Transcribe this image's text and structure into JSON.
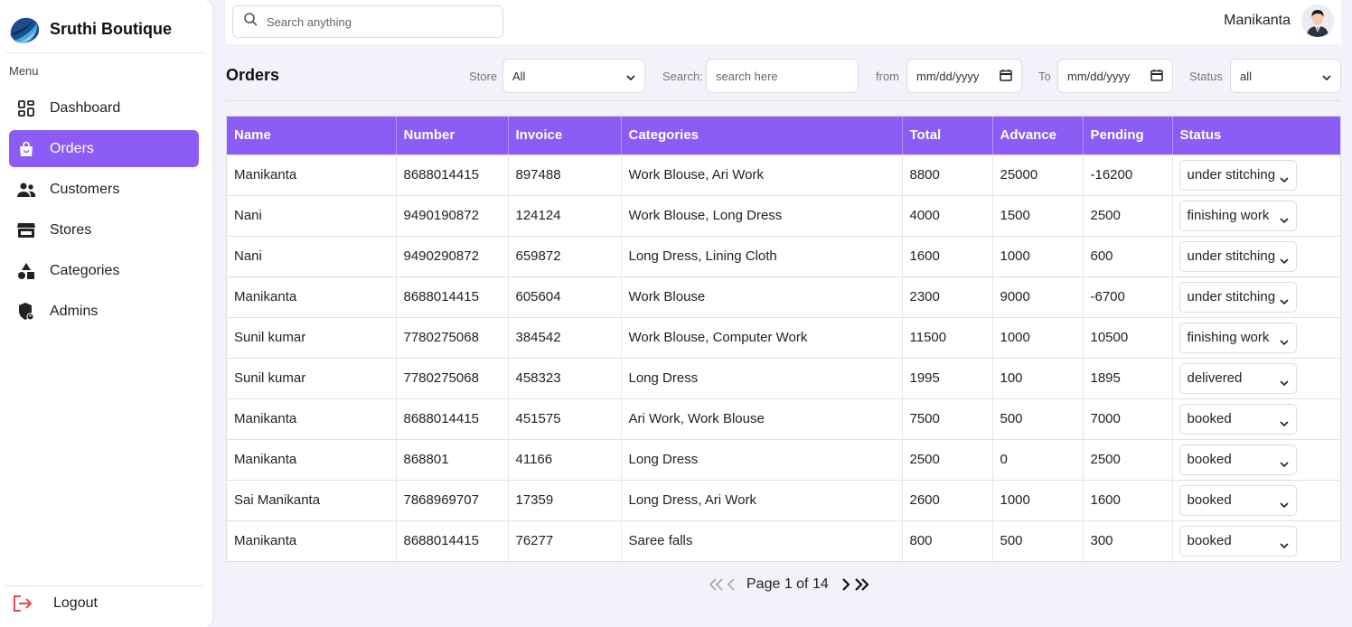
{
  "brand": {
    "name": "Sruthi Boutique"
  },
  "sidebar": {
    "menu_label": "Menu",
    "items": [
      {
        "label": "Dashboard",
        "icon": "dashboard-icon"
      },
      {
        "label": "Orders",
        "icon": "shopping-bag-icon"
      },
      {
        "label": "Customers",
        "icon": "users-icon"
      },
      {
        "label": "Stores",
        "icon": "store-icon"
      },
      {
        "label": "Categories",
        "icon": "shapes-icon"
      },
      {
        "label": "Admins",
        "icon": "shield-icon"
      }
    ],
    "active": "Orders",
    "logout_label": "Logout"
  },
  "topbar": {
    "search_placeholder": "Search anything",
    "user_name": "Manikanta"
  },
  "filters": {
    "title": "Orders",
    "store_label": "Store",
    "store_value": "All",
    "search_label": "Search:",
    "search_placeholder": "search here",
    "from_label": "from",
    "from_value": "mm/dd/yyyy",
    "to_label": "To",
    "to_value": "mm/dd/yyyy",
    "status_label": "Status",
    "status_value": "all"
  },
  "table": {
    "headers": [
      "Name",
      "Number",
      "Invoice",
      "Categories",
      "Total",
      "Advance",
      "Pending",
      "Status"
    ],
    "rows": [
      [
        "Manikanta",
        "8688014415",
        "897488",
        "Work Blouse, Ari Work",
        "8800",
        "25000",
        "-16200",
        "under stitching"
      ],
      [
        "Nani",
        "9490190872",
        "124124",
        "Work Blouse, Long Dress",
        "4000",
        "1500",
        "2500",
        "finishing work"
      ],
      [
        "Nani",
        "9490290872",
        "659872",
        "Long Dress, Lining Cloth",
        "1600",
        "1000",
        "600",
        "under stitching"
      ],
      [
        "Manikanta",
        "8688014415",
        "605604",
        "Work Blouse",
        "2300",
        "9000",
        "-6700",
        "under stitching"
      ],
      [
        "Sunil kumar",
        "7780275068",
        "384542",
        "Work Blouse, Computer Work",
        "11500",
        "1000",
        "10500",
        "finishing work"
      ],
      [
        "Sunil kumar",
        "7780275068",
        "458323",
        "Long Dress",
        "1995",
        "100",
        "1895",
        "delivered"
      ],
      [
        "Manikanta",
        "8688014415",
        "451575",
        "Ari Work, Work Blouse",
        "7500",
        "500",
        "7000",
        "booked"
      ],
      [
        "Manikanta",
        "868801",
        "41166",
        "Long Dress",
        "2500",
        "0",
        "2500",
        "booked"
      ],
      [
        "Sai Manikanta",
        "7868969707",
        "17359",
        "Long Dress, Ari Work",
        "2600",
        "1000",
        "1600",
        "booked"
      ],
      [
        "Manikanta",
        "8688014415",
        "76277",
        "Saree falls",
        "800",
        "500",
        "300",
        "booked"
      ]
    ]
  },
  "pagination": {
    "text": "Page 1 of 14"
  },
  "colors": {
    "accent": "#8b5cf6",
    "background": "#f3f2fb",
    "logout": "#e5484d"
  }
}
